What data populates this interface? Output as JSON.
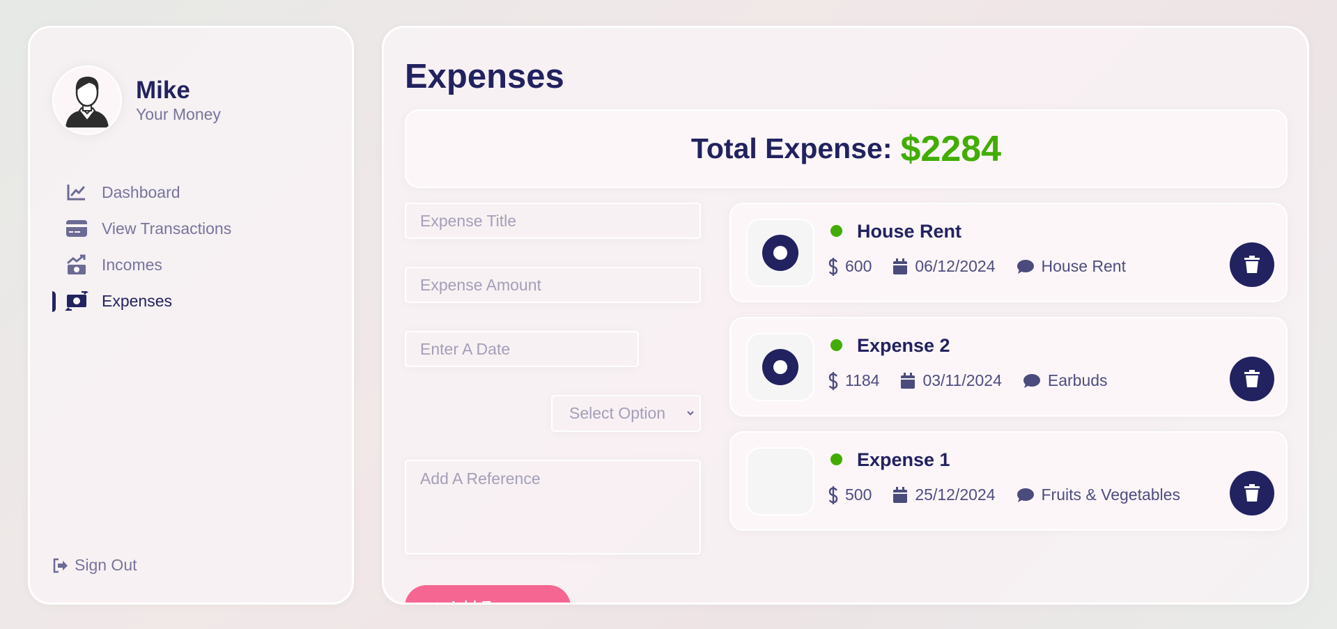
{
  "user": {
    "name": "Mike",
    "subtitle": "Your Money"
  },
  "menu": [
    {
      "label": "Dashboard",
      "icon": "chart-line-icon",
      "active": false
    },
    {
      "label": "View Transactions",
      "icon": "credit-card-icon",
      "active": false
    },
    {
      "label": "Incomes",
      "icon": "money-bill-trend-up-icon",
      "active": false
    },
    {
      "label": "Expenses",
      "icon": "money-bill-transfer-icon",
      "active": true
    }
  ],
  "signout": {
    "label": "Sign Out",
    "icon": "sign-out-icon"
  },
  "page": {
    "title": "Expenses"
  },
  "total": {
    "label": "Total Expense:",
    "amount": "$2284"
  },
  "form": {
    "title_placeholder": "Expense Title",
    "amount_placeholder": "Expense Amount",
    "date_placeholder": "Enter A Date",
    "select_value": "Select Option",
    "reference_placeholder": "Add A Reference",
    "add_label": "Add Expense"
  },
  "expenses": [
    {
      "title": "House Rent",
      "amount": "600",
      "date": "06/12/2024",
      "description": "House Rent",
      "icon": "circle-dot-icon"
    },
    {
      "title": "Expense 2",
      "amount": "1184",
      "date": "03/11/2024",
      "description": "Earbuds",
      "icon": "circle-dot-icon"
    },
    {
      "title": "Expense 1",
      "amount": "500",
      "date": "25/12/2024",
      "description": "Fruits & Vegetables",
      "icon": ""
    }
  ],
  "colors": {
    "primary": "#222260",
    "accent_green": "#42ad00",
    "button_pink": "#f56692"
  }
}
